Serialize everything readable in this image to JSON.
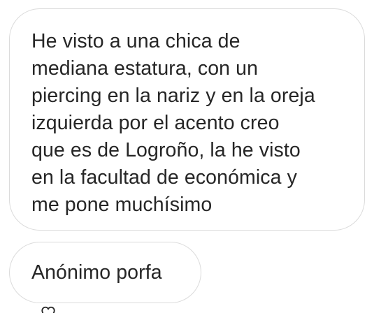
{
  "chat": {
    "messages": [
      {
        "text": "He visto a una chica de\nmediana estatura, con un\npiercing en la nariz y en la oreja\nizquierda por el acento creo\nque es de Logroño, la he visto\nen la facultad de económica y\nme pone muchísimo"
      },
      {
        "text": "Anónimo porfa"
      }
    ],
    "like_icon": "heart-outline-icon"
  },
  "colors": {
    "background": "#ffffff",
    "bubble_border": "#dbdbdb",
    "text": "#262626"
  }
}
